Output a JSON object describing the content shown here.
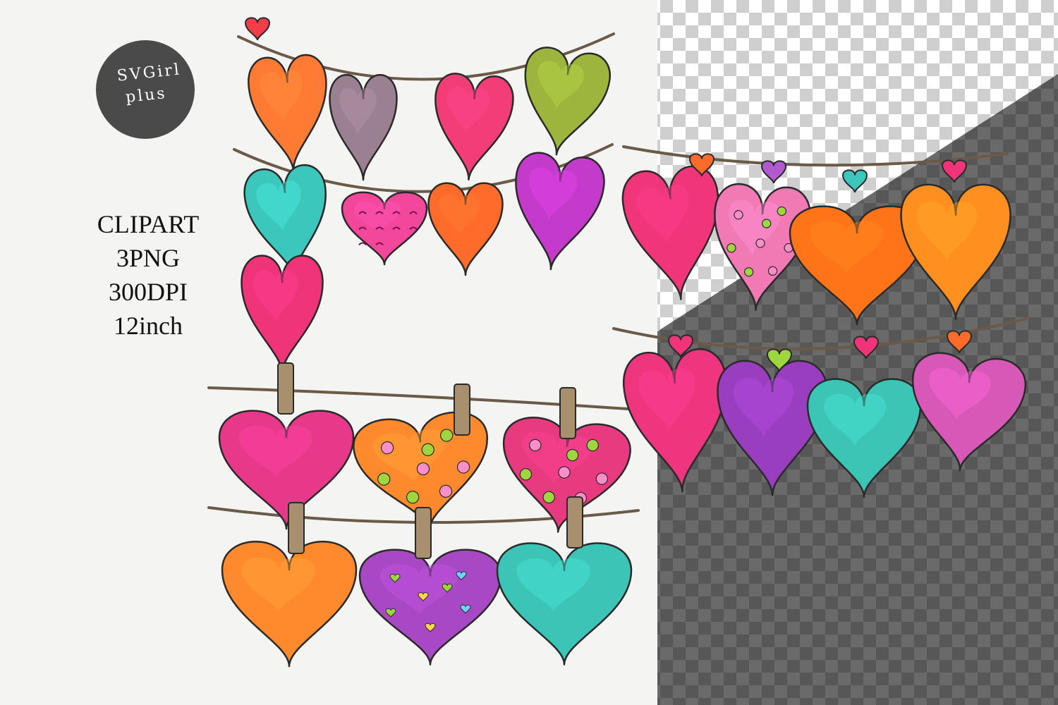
{
  "logo": {
    "line1": "SVGirl",
    "line2": "plus",
    "badge_color": "#4a4a4a",
    "text_color": "#ffffff"
  },
  "specs": [
    "CLIPART",
    "3PNG",
    "300DPI",
    "12inch"
  ],
  "colors": {
    "background": "#f4f4f2",
    "checker_light": "#ffffff",
    "checker_mid": "#cfcfcf",
    "checker_dark_a": "#6a6a6a",
    "checker_dark_b": "#5a5a5a",
    "string": "#6b5a48",
    "clothespin": "#a8906f",
    "outline": "#2a2a2a"
  },
  "hearts": [
    {
      "color": "#ff7a33",
      "pattern": "plain"
    },
    {
      "color": "#9a8090",
      "pattern": "plain"
    },
    {
      "color": "#f23d78",
      "pattern": "plain"
    },
    {
      "color": "#9db53c",
      "pattern": "plain"
    },
    {
      "color": "#3cc7bd",
      "pattern": "plain"
    },
    {
      "color": "#f2479a",
      "pattern": "scribble"
    },
    {
      "color": "#ff6b2a",
      "pattern": "plain"
    },
    {
      "color": "#c43acb",
      "pattern": "plain"
    },
    {
      "color": "#f0347a",
      "pattern": "plain"
    },
    {
      "color": "#e8388a",
      "pattern": "plain"
    },
    {
      "color": "#ff8a2e",
      "pattern": "dots"
    },
    {
      "color": "#e83a7e",
      "pattern": "dots"
    },
    {
      "color": "#ff8a2e",
      "pattern": "plain"
    },
    {
      "color": "#a848c4",
      "pattern": "mini-hearts"
    },
    {
      "color": "#3cc4b6",
      "pattern": "plain"
    },
    {
      "color": "#f0357a",
      "pattern": "plain"
    },
    {
      "color": "#f27ab4",
      "pattern": "dots"
    },
    {
      "color": "#ff7418",
      "pattern": "plain"
    },
    {
      "color": "#ff8f1f",
      "pattern": "plain"
    },
    {
      "color": "#f0357f",
      "pattern": "plain"
    },
    {
      "color": "#9a3ec0",
      "pattern": "plain"
    },
    {
      "color": "#3cc4b4",
      "pattern": "plain"
    },
    {
      "color": "#d858b8",
      "pattern": "plain"
    }
  ]
}
